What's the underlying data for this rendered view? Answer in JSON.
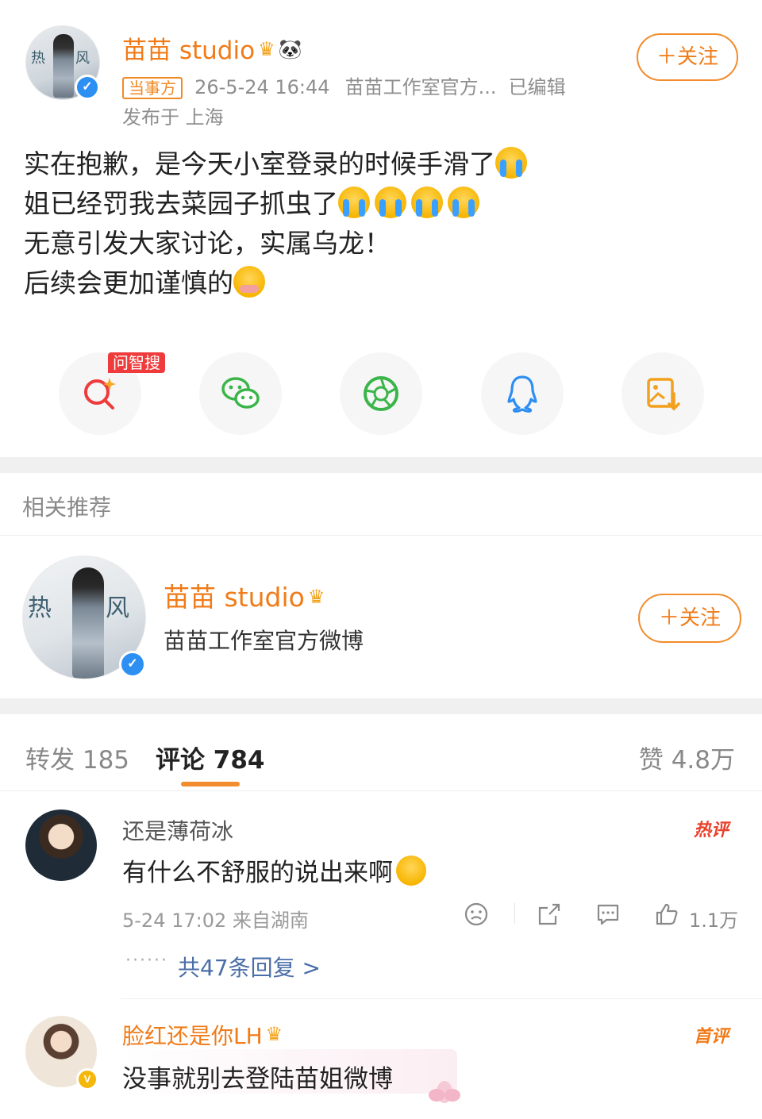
{
  "post": {
    "author": "苗苗 studio",
    "tag": "当事方",
    "time": "26-5-24 16:44",
    "source": "苗苗工作室官方...",
    "edited": "已编辑",
    "location": "发布于 上海",
    "follow_label": "＋关注",
    "lines": [
      "实在抱歉，是今天小室登录的时候手滑了",
      "姐已经罚我去菜园子抓虫了",
      "无意引发大家讨论，实属乌龙！",
      "后续会更加谨慎的"
    ]
  },
  "share": {
    "ask_badge": "问智搜",
    "items": [
      "ask-search",
      "wechat",
      "moments",
      "qq",
      "save-image"
    ]
  },
  "related": {
    "section_title": "相关推荐",
    "name": "苗苗 studio",
    "desc": "苗苗工作室官方微博",
    "follow_label": "＋关注"
  },
  "tabs": {
    "repost": "转发 185",
    "comment": "评论 784",
    "like": "赞 4.8万"
  },
  "comments": [
    {
      "name": "还是薄荷冰",
      "text": "有什么不舒服的说出来啊",
      "badge": "热评",
      "meta": "5-24 17:02  来自湖南",
      "likes": "1.1万",
      "replies": "共47条回复 >",
      "dots": "······"
    },
    {
      "name": "脸红还是你LH",
      "text": "没事就别去登陆苗姐微博",
      "badge": "首评"
    }
  ],
  "colors": {
    "accent": "#f07b18",
    "link": "#4a6ea8",
    "hot": "#e8422c",
    "verified": "#2d8ff2"
  }
}
